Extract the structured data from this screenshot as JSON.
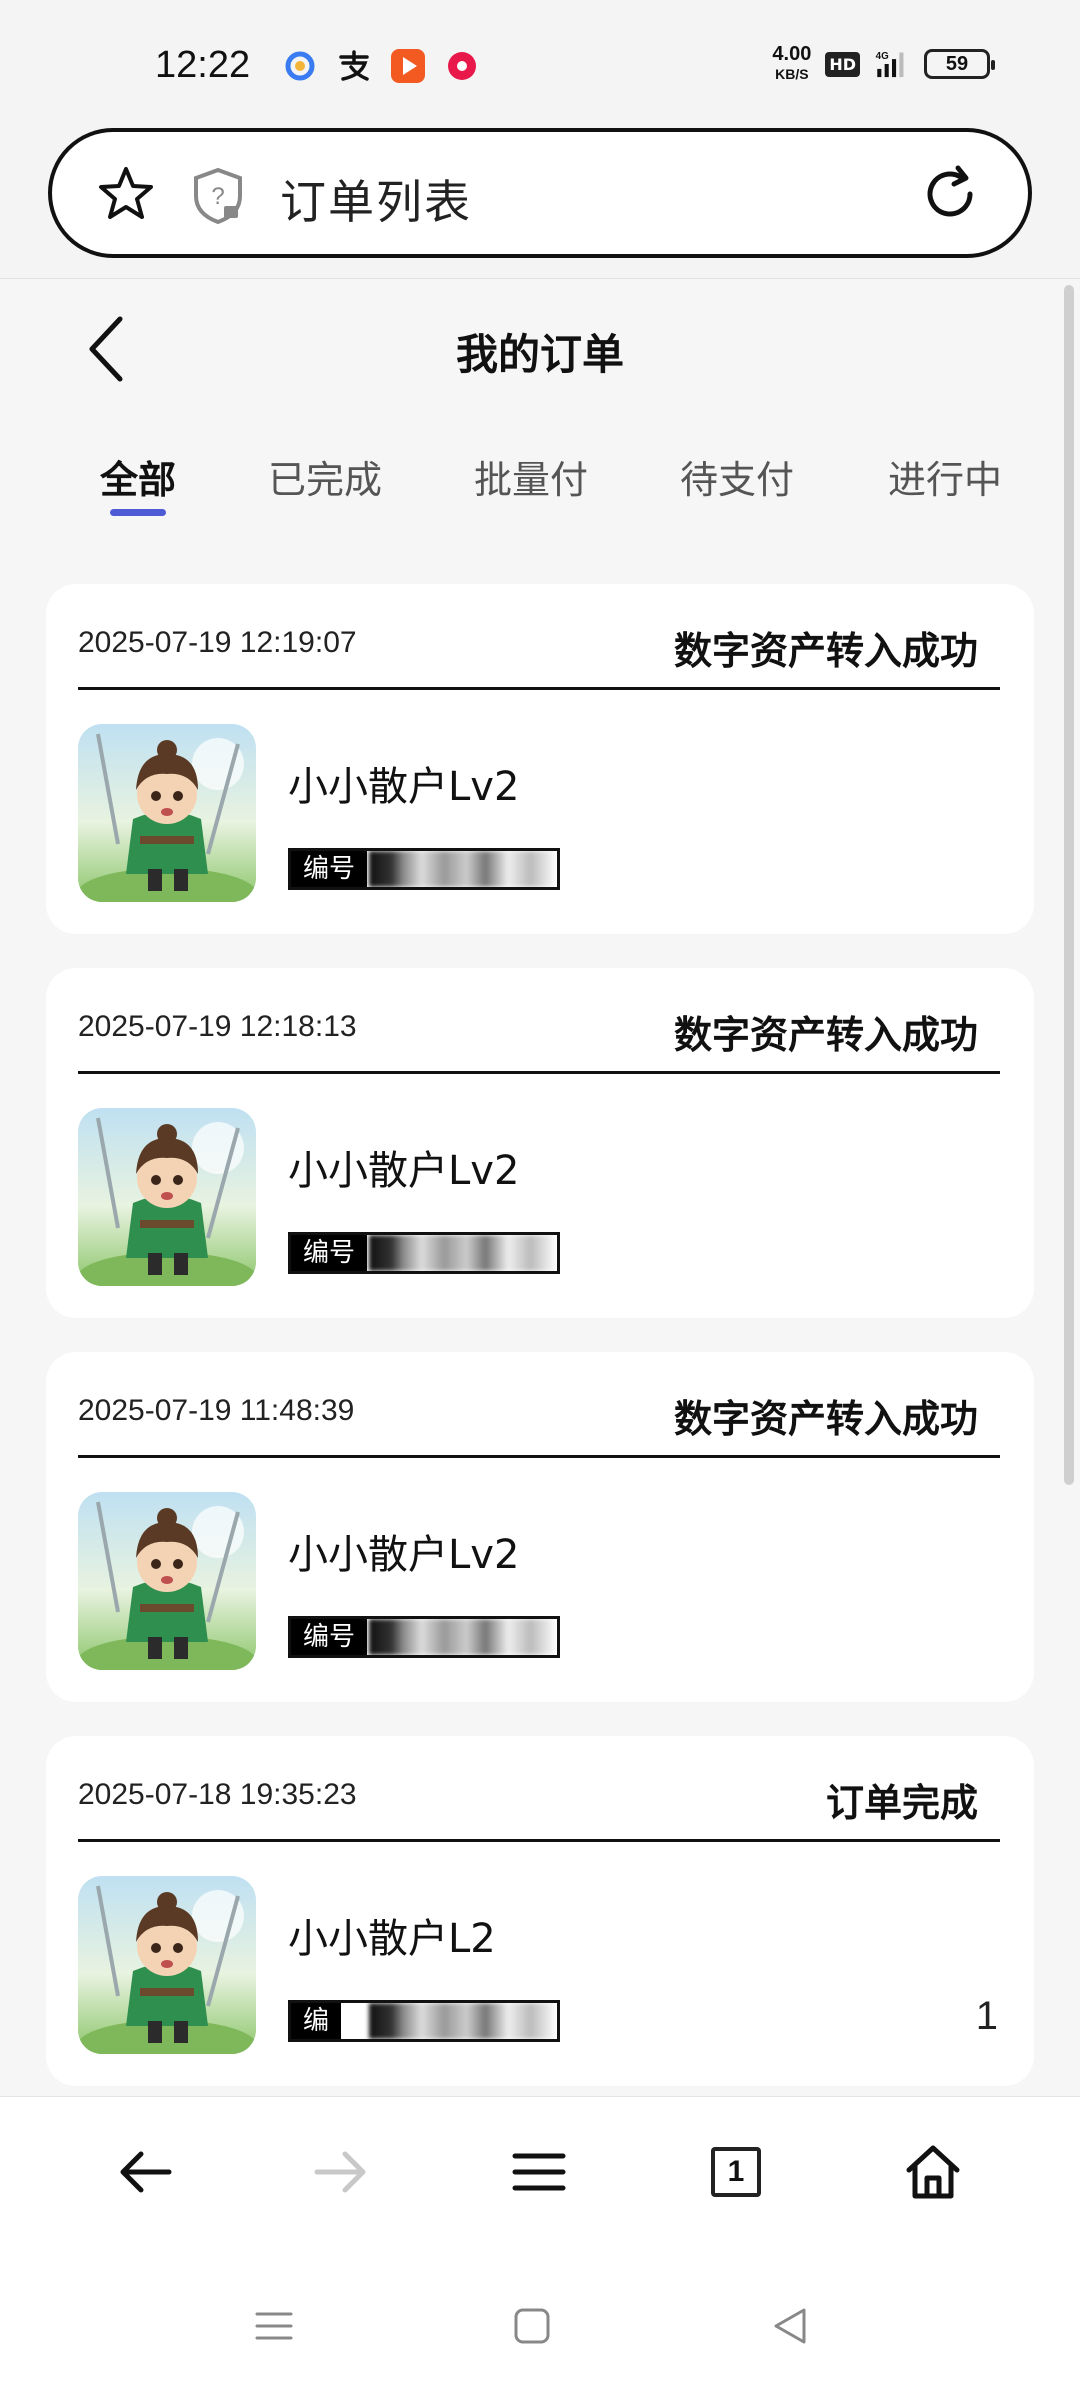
{
  "status_bar": {
    "time": "12:22",
    "left_icons": [
      "qq-browser-icon",
      "alipay-icon",
      "video-app-icon",
      "music-app-icon"
    ],
    "network_speed": "4.00",
    "network_speed_unit": "KB/S",
    "hd_label": "HD",
    "signal_label": "4G",
    "battery": "59"
  },
  "address_bar": {
    "title": "订单列表"
  },
  "page": {
    "title": "我的订单",
    "tabs": [
      {
        "label": "全部",
        "active": true
      },
      {
        "label": "已完成",
        "active": false
      },
      {
        "label": "批量付",
        "active": false
      },
      {
        "label": "待支付",
        "active": false
      },
      {
        "label": "进行中",
        "active": false
      }
    ],
    "accent_color": "#4f5bd5"
  },
  "orders": [
    {
      "time": "2025-07-19 12:19:07",
      "status": "数字资产转入成功",
      "product": "小小散户Lv2",
      "serial_label": "编号",
      "serial_value": "00",
      "qty": ""
    },
    {
      "time": "2025-07-19 12:18:13",
      "status": "数字资产转入成功",
      "product": "小小散户Lv2",
      "serial_label": "编号",
      "serial_value": "",
      "qty": ""
    },
    {
      "time": "2025-07-19 11:48:39",
      "status": "数字资产转入成功",
      "product": "小小散户Lv2",
      "serial_label": "编号",
      "serial_value": "",
      "qty": ""
    },
    {
      "time": "2025-07-18 19:35:23",
      "status": "订单完成",
      "product": "小小散户L2",
      "serial_label": "编",
      "serial_value": "",
      "qty": "1"
    }
  ],
  "browser_toolbar": {
    "tab_count": "1"
  }
}
